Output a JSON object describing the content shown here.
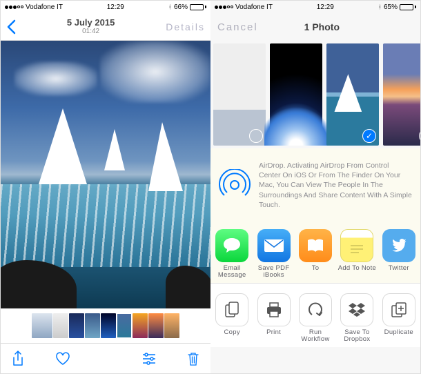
{
  "left": {
    "status": {
      "carrier": "Vodafone IT",
      "time": "12:29",
      "bluetooth": true,
      "battery_pct": "66%"
    },
    "nav": {
      "date": "5 July 2015",
      "time": "01:42",
      "details_label": "Details"
    },
    "thumbnails": [
      {
        "name": "hazy-landscape",
        "selected": false
      },
      {
        "name": "document-white",
        "selected": false
      },
      {
        "name": "blue-gradient",
        "selected": false
      },
      {
        "name": "ocean-wave",
        "selected": false
      },
      {
        "name": "earth-space",
        "selected": false
      },
      {
        "name": "sailboats",
        "selected": true
      },
      {
        "name": "sunset-purple",
        "selected": false
      },
      {
        "name": "sunset-orange",
        "selected": false
      },
      {
        "name": "beach-sunset",
        "selected": false
      }
    ],
    "toolbar": {
      "share": "share-icon",
      "favorite": "heart-icon",
      "adjust": "sliders-icon",
      "delete": "trash-icon"
    }
  },
  "right": {
    "status": {
      "carrier": "Vodafone IT",
      "time": "12:29",
      "bluetooth": true,
      "battery_pct": "65%"
    },
    "nav": {
      "cancel_label": "Cancel",
      "count_label": "1 Photo"
    },
    "picker": [
      {
        "name": "document-white",
        "selected": false
      },
      {
        "name": "earth-space",
        "selected": false
      },
      {
        "name": "sailboats",
        "selected": true
      },
      {
        "name": "sunset-pier",
        "selected": false
      }
    ],
    "airdrop": {
      "text": "AirDrop. Activating AirDrop From Control Center On iOS Or From The Finder On Your Mac, You Can View The People In The Surroundings And Share Content With A Simple Touch."
    },
    "share_apps": [
      {
        "id": "message",
        "label": "Email Message",
        "icon": "message-bubble-icon"
      },
      {
        "id": "savepdf",
        "label": "Save PDF iBooks",
        "icon": "mail-envelope-icon"
      },
      {
        "id": "ibooks",
        "label": "To",
        "icon": "ibooks-icon"
      },
      {
        "id": "notes",
        "label": "Add To Note",
        "icon": "notes-icon"
      },
      {
        "id": "twitter",
        "label": "Twitter",
        "icon": "twitter-icon"
      }
    ],
    "actions": [
      {
        "id": "copy",
        "label": "Copy",
        "icon": "copy-icon"
      },
      {
        "id": "print",
        "label": "Print",
        "icon": "print-icon"
      },
      {
        "id": "workflow",
        "label": "Run Workflow",
        "icon": "workflow-icon"
      },
      {
        "id": "dropbox",
        "label": "Save To Dropbox",
        "icon": "dropbox-icon"
      },
      {
        "id": "duplicate",
        "label": "Duplicate",
        "icon": "duplicate-icon"
      }
    ]
  },
  "colors": {
    "tint": "#007aff",
    "green": "#4cd964"
  }
}
